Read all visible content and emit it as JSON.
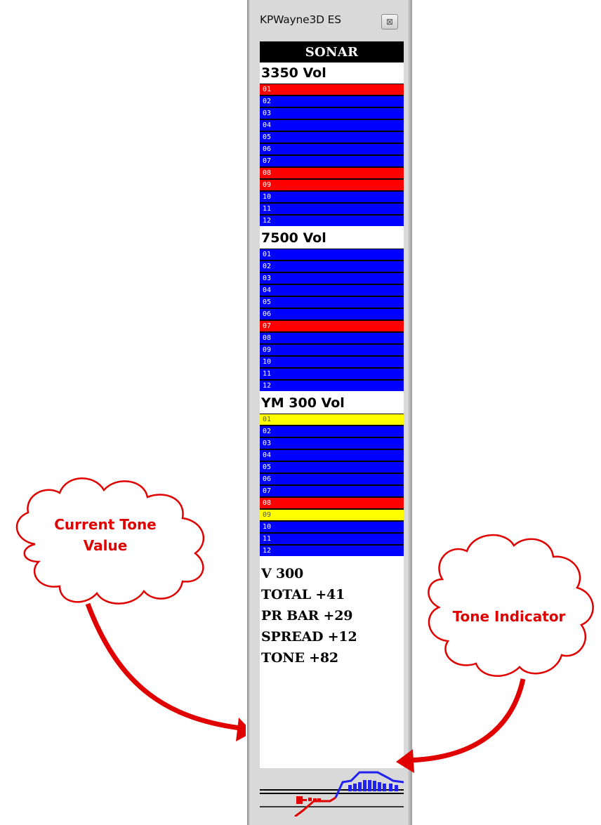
{
  "window": {
    "title": "KPWayne3D ES",
    "close_glyph": "⊠",
    "header": "SONAR"
  },
  "groups": [
    {
      "title": "3350 Vol",
      "rows": [
        {
          "label": "01",
          "color": "red"
        },
        {
          "label": "02",
          "color": "blue"
        },
        {
          "label": "03",
          "color": "blue"
        },
        {
          "label": "04",
          "color": "blue"
        },
        {
          "label": "05",
          "color": "blue"
        },
        {
          "label": "06",
          "color": "blue"
        },
        {
          "label": "07",
          "color": "blue"
        },
        {
          "label": "08",
          "color": "red"
        },
        {
          "label": "09",
          "color": "red"
        },
        {
          "label": "10",
          "color": "blue"
        },
        {
          "label": "11",
          "color": "blue"
        },
        {
          "label": "12",
          "color": "blue"
        }
      ]
    },
    {
      "title": "7500 Vol",
      "rows": [
        {
          "label": "01",
          "color": "blue"
        },
        {
          "label": "02",
          "color": "blue"
        },
        {
          "label": "03",
          "color": "blue"
        },
        {
          "label": "04",
          "color": "blue"
        },
        {
          "label": "05",
          "color": "blue"
        },
        {
          "label": "06",
          "color": "blue"
        },
        {
          "label": "07",
          "color": "red"
        },
        {
          "label": "08",
          "color": "blue"
        },
        {
          "label": "09",
          "color": "blue"
        },
        {
          "label": "10",
          "color": "blue"
        },
        {
          "label": "11",
          "color": "blue"
        },
        {
          "label": "12",
          "color": "blue"
        }
      ]
    },
    {
      "title": "YM 300 Vol",
      "rows": [
        {
          "label": "01",
          "color": "yellow"
        },
        {
          "label": "02",
          "color": "blue"
        },
        {
          "label": "03",
          "color": "blue"
        },
        {
          "label": "04",
          "color": "blue"
        },
        {
          "label": "05",
          "color": "blue"
        },
        {
          "label": "06",
          "color": "blue"
        },
        {
          "label": "07",
          "color": "blue"
        },
        {
          "label": "08",
          "color": "red"
        },
        {
          "label": "09",
          "color": "yellow"
        },
        {
          "label": "10",
          "color": "blue"
        },
        {
          "label": "11",
          "color": "blue"
        },
        {
          "label": "12",
          "color": "blue"
        }
      ]
    }
  ],
  "stats": {
    "v": "V 300",
    "total": "TOTAL +41",
    "pr_bar": "PR BAR +29",
    "spread": "SPREAD +12",
    "tone": "TONE +82"
  },
  "annotations": {
    "left_line1": "Current Tone",
    "left_line2": "Value",
    "right": "Tone Indicator"
  },
  "colors": {
    "row_blue": "#0000ff",
    "row_red": "#ff0000",
    "row_yellow": "#ffff00",
    "annotation_red": "#e00000",
    "indicator_line_blue": "#2222ee",
    "indicator_line_red": "#e00000"
  }
}
